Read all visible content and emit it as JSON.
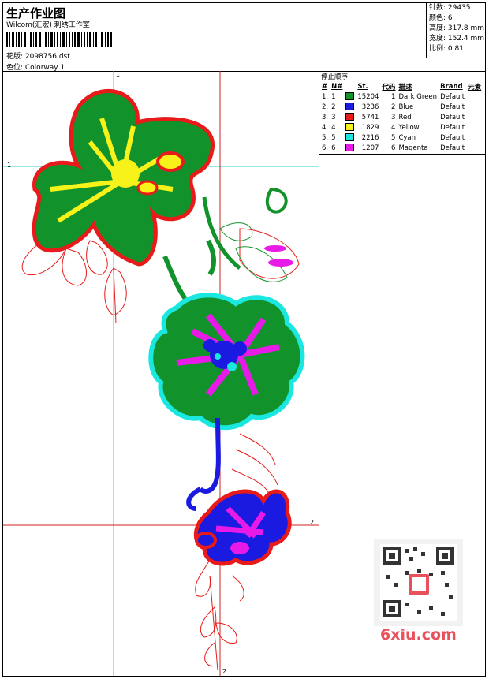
{
  "header": {
    "title": "生产作业图",
    "company": "Wilcom(汇宏) 刺绣工作室",
    "design_label": "花版: 2098756.dst",
    "colorway_label": "色位: Colorway 1"
  },
  "stats": {
    "stitches": "针数: 29435",
    "colors": "颜色: 6",
    "height": "高度: 317.8 mm",
    "width": "宽度: 152.4 mm",
    "scale": "比例: 0.81"
  },
  "stop_sequence": {
    "title": "停止顺序:",
    "headers": [
      "#",
      "N#",
      "St.",
      "代码",
      "描述",
      "Brand",
      "元素"
    ],
    "rows": [
      {
        "idx": "1.",
        "n": "1",
        "color": "#12922a",
        "st": "15204",
        "code": "1",
        "desc": "Dark Green",
        "brand": "Default"
      },
      {
        "idx": "2.",
        "n": "2",
        "color": "#1a1ae0",
        "st": "3236",
        "code": "2",
        "desc": "Blue",
        "brand": "Default"
      },
      {
        "idx": "3.",
        "n": "3",
        "color": "#e81a1a",
        "st": "5741",
        "code": "3",
        "desc": "Red",
        "brand": "Default"
      },
      {
        "idx": "4.",
        "n": "4",
        "color": "#f7f21a",
        "st": "1829",
        "code": "4",
        "desc": "Yellow",
        "brand": "Default"
      },
      {
        "idx": "5.",
        "n": "5",
        "color": "#1ae8e0",
        "st": "2216",
        "code": "5",
        "desc": "Cyan",
        "brand": "Default"
      },
      {
        "idx": "6.",
        "n": "6",
        "color": "#e81ae8",
        "st": "1207",
        "code": "6",
        "desc": "Magenta",
        "brand": "Default"
      }
    ]
  },
  "guides": {
    "one": "1",
    "two": "2"
  },
  "watermark": {
    "text": "6xiu.com"
  },
  "colors": {
    "dark_green": "#12922a",
    "blue": "#1a1ae0",
    "red": "#e81a1a",
    "yellow": "#f7f21a",
    "cyan": "#1ae8e0",
    "magenta": "#e81ae8",
    "guide_cyan": "#33cccc",
    "guide_red": "#cc2222"
  }
}
